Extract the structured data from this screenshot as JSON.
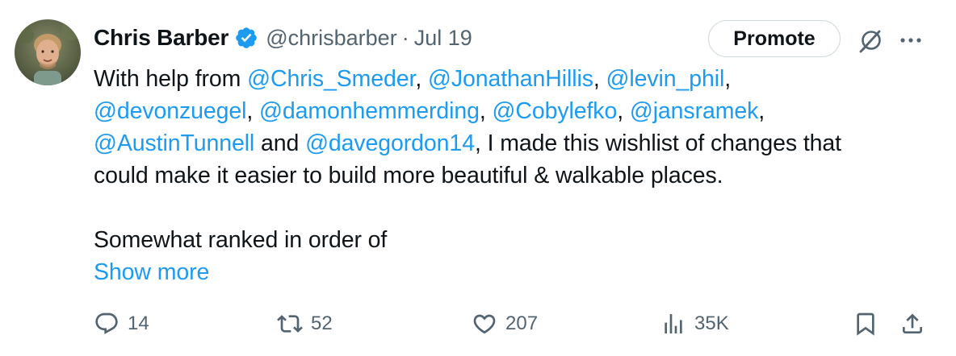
{
  "author": {
    "name": "Chris Barber",
    "handle": "@chrisbarber",
    "separator": "·",
    "date": "Jul 19"
  },
  "header": {
    "promote_label": "Promote"
  },
  "icons": {
    "verified": "verified-badge-icon",
    "grok": "grok-icon",
    "more": "more-icon",
    "reply": "reply-icon",
    "retweet": "retweet-icon",
    "like": "like-icon",
    "views": "views-icon",
    "bookmark": "bookmark-icon",
    "share": "share-icon"
  },
  "colors": {
    "accent": "#1d9bf0",
    "text": "#0f1419",
    "muted": "#536471",
    "verified": "#1d9bf0"
  },
  "body": {
    "l1_t1": "With help from ",
    "l1_m1": "@Chris_Smeder",
    "l1_t2": ", ",
    "l1_m2": "@JonathanHillis",
    "l1_t3": ", ",
    "l1_m3": "@levin_phil",
    "l1_t4": ",",
    "l2_m1": "@devonzuegel",
    "l2_t1": ", ",
    "l2_m2": "@damonhemmerding",
    "l2_t2": ", ",
    "l2_m3": "@Cobylefko",
    "l2_t3": ", ",
    "l2_m4": "@jansramek",
    "l2_t4": ",",
    "l3_m1": "@AustinTunnell",
    "l3_t1": " and ",
    "l3_m2": "@davegordon14",
    "l3_t2": ", I made this wishlist of changes that",
    "l4": "could make it easier to build more beautiful & walkable places.",
    "l6": "Somewhat ranked in order of",
    "show_more": "Show more"
  },
  "actions": {
    "replies": "14",
    "reposts": "52",
    "likes": "207",
    "views": "35K"
  }
}
